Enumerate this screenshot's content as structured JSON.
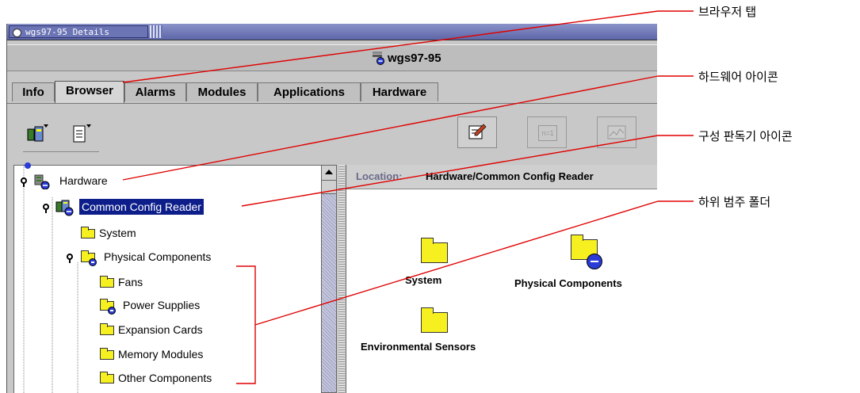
{
  "window": {
    "title": "wgs97-95 Details",
    "hostname": "wgs97-95"
  },
  "tabs": [
    {
      "label": "Info",
      "active": false
    },
    {
      "label": "Browser",
      "active": true
    },
    {
      "label": "Alarms",
      "active": false
    },
    {
      "label": "Modules",
      "active": false
    },
    {
      "label": "Applications",
      "active": false
    },
    {
      "label": "Hardware",
      "active": false
    }
  ],
  "toolbar": {
    "left_icons": [
      "hardware-view-icon",
      "document-icon"
    ],
    "right_buttons": [
      "edit-icon",
      "n-equals-1-icon",
      "graph-icon"
    ],
    "n1_label": "n=1"
  },
  "tree": {
    "hardware": "Hardware",
    "config_reader": "Common Config Reader",
    "system": "System",
    "physical_components": "Physical Components",
    "fans": "Fans",
    "power_supplies": "Power Supplies",
    "expansion_cards": "Expansion Cards",
    "memory_modules": "Memory Modules",
    "other_components": "Other Components"
  },
  "content": {
    "location_label": "Location:",
    "location_value": "Hardware/Common Config Reader",
    "items": [
      "System",
      "Physical Components",
      "Environmental Sensors"
    ]
  },
  "callouts": {
    "browser_tab": "브라우저 탭",
    "hardware_icon": "하드웨어 아이콘",
    "config_reader_icon": "구성 판독기 아이콘",
    "subcategory_folder": "하위 범주 폴더"
  },
  "colors": {
    "selection": "#0d1e8a",
    "folder": "#f7f020",
    "badge": "#2a3bd6",
    "callout_line": "#e00000"
  }
}
